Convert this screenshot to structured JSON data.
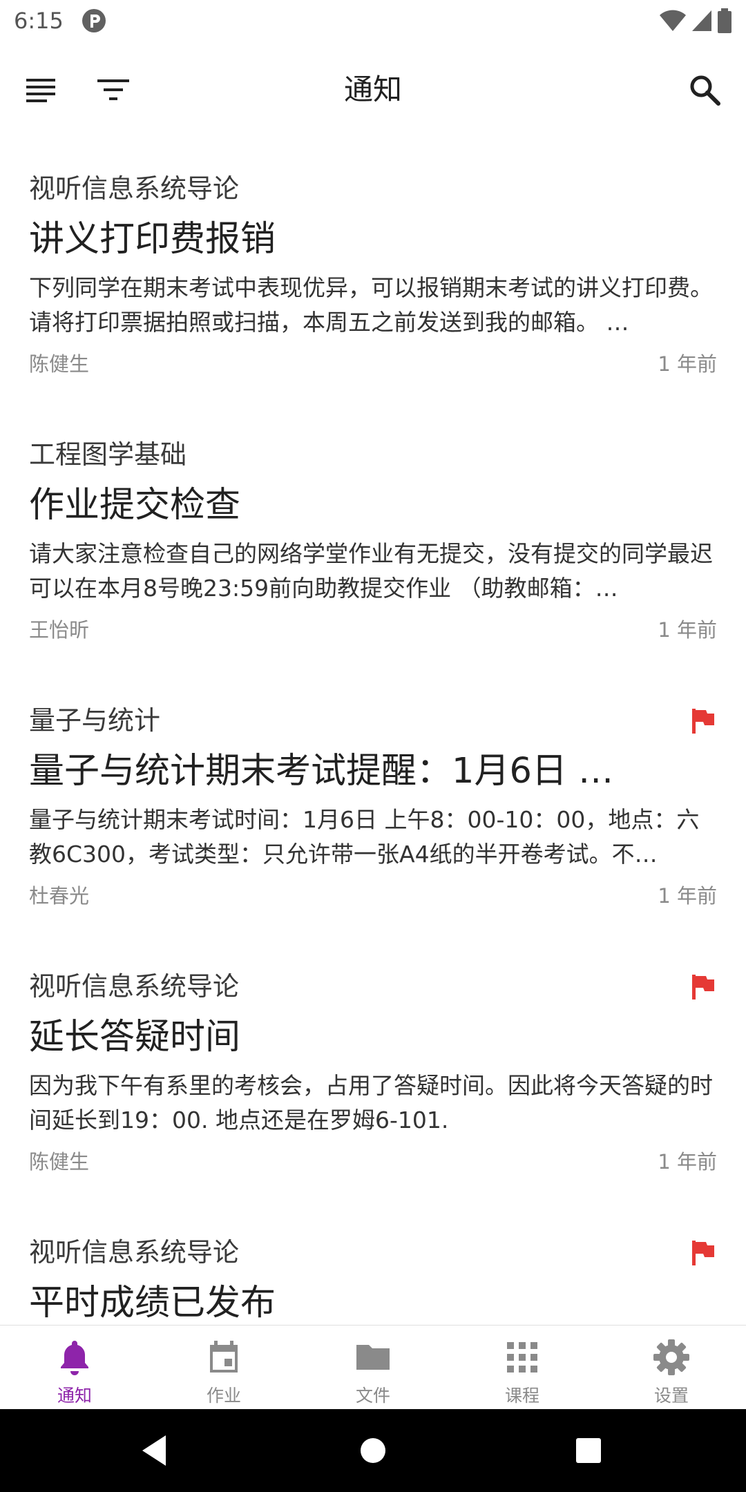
{
  "status_bar": {
    "time": "6:15"
  },
  "app_bar": {
    "title": "通知"
  },
  "notices": [
    {
      "course": "视听信息系统导论",
      "title": "讲义打印费报销",
      "body": "下列同学在期末考试中表现优异，可以报销期末考试的讲义打印费。请将打印票据拍照或扫描，本周五之前发送到我的邮箱。 …",
      "author": "陈健生",
      "time": "1 年前",
      "flagged": false
    },
    {
      "course": "工程图学基础",
      "title": "作业提交检查",
      "body": "请大家注意检查自己的网络学堂作业有无提交，没有提交的同学最迟可以在本月8号晚23:59前向助教提交作业 （助教邮箱：…",
      "author": "王怡昕",
      "time": "1 年前",
      "flagged": false
    },
    {
      "course": "量子与统计",
      "title": "量子与统计期末考试提醒：1月6日 …",
      "body": "量子与统计期末考试时间：1月6日 上午8：00-10：00，地点：六教6C300，考试类型：只允许带一张A4纸的半开卷考试。不…",
      "author": "杜春光",
      "time": "1 年前",
      "flagged": true
    },
    {
      "course": "视听信息系统导论",
      "title": "延长答疑时间",
      "body": "因为我下午有系里的考核会，占用了答疑时间。因此将今天答疑的时间延长到19：00. 地点还是在罗姆6-101.",
      "author": "陈健生",
      "time": "1 年前",
      "flagged": true
    },
    {
      "course": "视听信息系统导论",
      "title": "平时成绩已发布",
      "body": "",
      "author": "",
      "time": "",
      "flagged": true
    }
  ],
  "bottom_nav": [
    {
      "label": "通知",
      "icon": "bell-icon",
      "active": true
    },
    {
      "label": "作业",
      "icon": "calendar-icon",
      "active": false
    },
    {
      "label": "文件",
      "icon": "folder-icon",
      "active": false
    },
    {
      "label": "课程",
      "icon": "apps-grid-icon",
      "active": false
    },
    {
      "label": "设置",
      "icon": "gear-icon",
      "active": false
    }
  ],
  "colors": {
    "accent": "#8e24aa",
    "flag": "#e53935",
    "inactive": "#8a8a8a"
  }
}
